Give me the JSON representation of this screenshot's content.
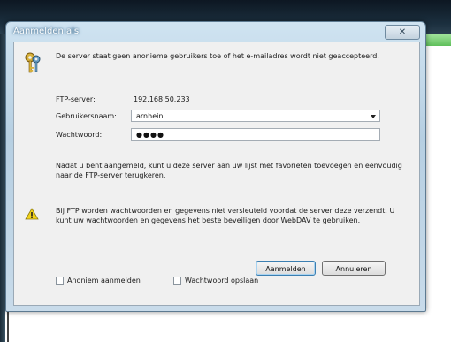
{
  "dialog": {
    "title": "Aanmelden als",
    "close_label": "✕",
    "message": "De server staat geen anonieme gebruikers toe of het e-mailadres wordt niet geaccepteerd.",
    "ftp_server_label": "FTP-server:",
    "ftp_server_value": "192.168.50.233",
    "username_label": "Gebruikersnaam:",
    "username_value": "arnhein",
    "password_label": "Wachtwoord:",
    "password_value": "●●●●",
    "info_text": "Nadat u bent aangemeld, kunt u deze server aan uw lijst met favorieten toevoegen en eenvoudig naar de FTP-server terugkeren.",
    "warning_text": "Bij FTP worden wachtwoorden en gegevens niet versleuteld voordat de server deze verzendt. U kunt uw wachtwoorden en gegevens het beste beveiligen door WebDAV te gebruiken.",
    "anonymous_checkbox_label": "Anoniem aanmelden",
    "save_password_checkbox_label": "Wachtwoord opslaan",
    "login_button_label": "Aanmelden",
    "cancel_button_label": "Annuleren"
  },
  "icons": {
    "key": "keys-icon",
    "warning": "warning-icon"
  },
  "colors": {
    "titlebar_glow": "#3d6b8f",
    "warning_yellow": "#f2d21a",
    "accent_green": "#5fbf5b"
  }
}
